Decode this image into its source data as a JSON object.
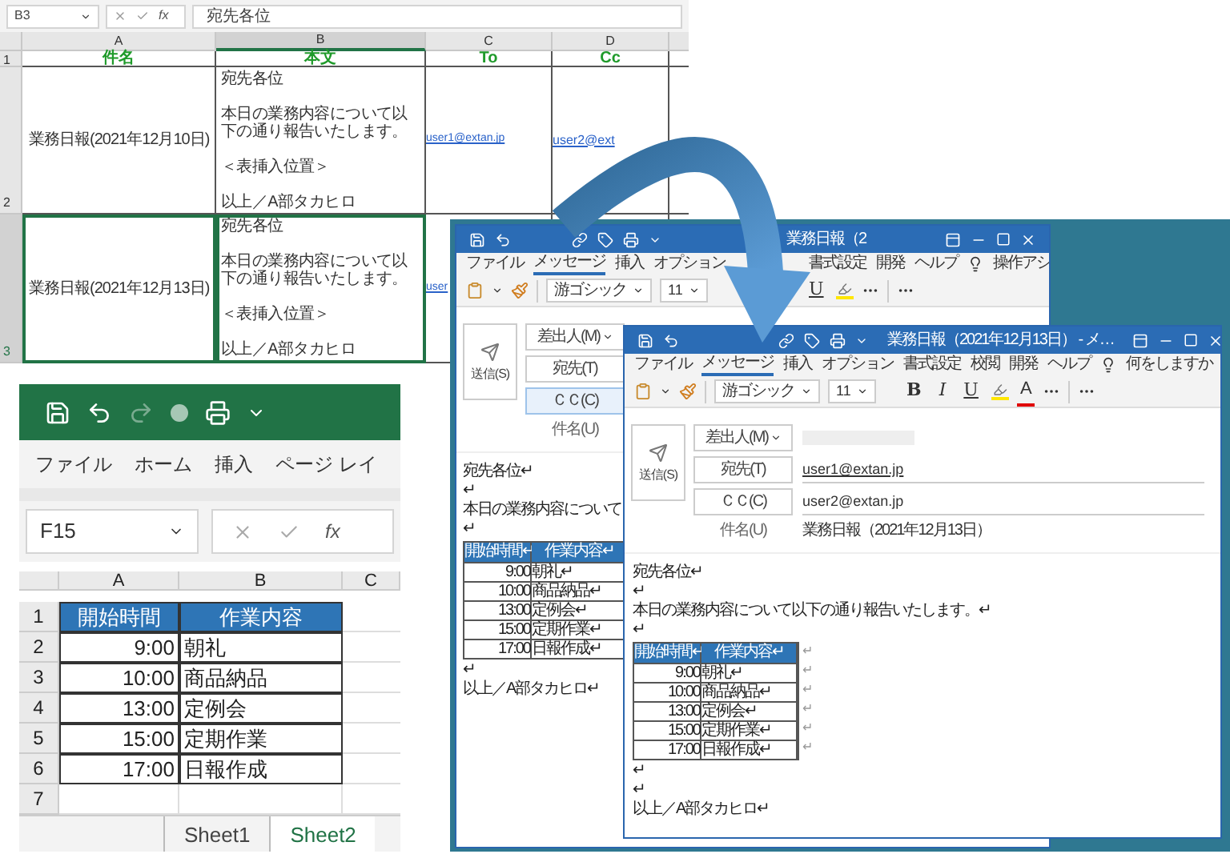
{
  "excel_top": {
    "name_box": "B3",
    "function_label": "fx",
    "formula": "宛先各位",
    "columns": [
      {
        "label": "A",
        "selected": false
      },
      {
        "label": "B",
        "selected": true
      },
      {
        "label": "C",
        "selected": false
      },
      {
        "label": "D",
        "selected": false
      }
    ],
    "header_row": {
      "number": "1",
      "cells": [
        "件名",
        "本文",
        "To",
        "Cc"
      ]
    },
    "rows": [
      {
        "number": "2",
        "selected": false,
        "subject": "業務日報(2021年12月10日)",
        "body": [
          "宛先各位",
          "本日の業務内容について以下の通り報告いたします。",
          "＜表挿入位置＞",
          "以上／A部タカヒロ"
        ],
        "to": "user1@extan.jp",
        "cc": "user2@ext"
      },
      {
        "number": "3",
        "selected": true,
        "subject": "業務日報(2021年12月13日)",
        "body": [
          "宛先各位",
          "本日の業務内容について以下の通り報告いたします。",
          "＜表挿入位置＞",
          "以上／A部タカヒロ"
        ],
        "to": "user"
      }
    ]
  },
  "excel_sheet": {
    "menu": [
      "ファイル",
      "ホーム",
      "挿入",
      "ページ レイ"
    ],
    "name_box": "F15",
    "function_label": "fx",
    "columns": [
      "A",
      "B",
      "C"
    ],
    "row_numbers": [
      "1",
      "2",
      "3",
      "4",
      "5",
      "6",
      "7"
    ],
    "table": {
      "header": [
        "開始時間",
        "作業内容"
      ],
      "rows": [
        [
          "9:00",
          "朝礼"
        ],
        [
          "10:00",
          "商品納品"
        ],
        [
          "13:00",
          "定例会"
        ],
        [
          "15:00",
          "定期作業"
        ],
        [
          "17:00",
          "日報作成"
        ]
      ]
    },
    "sheet_tabs": [
      {
        "label": "Sheet1",
        "selected": false
      },
      {
        "label": "Sheet2",
        "selected": true
      }
    ]
  },
  "back_mail": {
    "title": "業務日報（2",
    "menu": [
      {
        "label": "ファイル",
        "selected": false
      },
      {
        "label": "メッセージ",
        "selected": true
      },
      {
        "label": "挿入",
        "selected": false
      },
      {
        "label": "オプション",
        "selected": false
      },
      {
        "label": "書式設定",
        "selected": false
      },
      {
        "label": "開発",
        "selected": false
      },
      {
        "label": "ヘルプ",
        "selected": false
      }
    ],
    "tell_me": "操作アシ",
    "font": "游ゴシック",
    "size": "11",
    "format_buttons": [
      "U"
    ],
    "send": "送信(S)",
    "from_button": "差出人(M)",
    "to_button": "宛先(T)",
    "cc_button": {
      "label": "ＣＣ(C)",
      "focused": true
    },
    "subject_label": "件名(U)",
    "body": {
      "lines": [
        "宛先各位↵",
        "↵",
        "本日の業務内容について",
        "↵"
      ],
      "table": {
        "header": [
          "開始時間↵",
          "作業内容↵"
        ],
        "rows": [
          [
            "9:00",
            "朝礼↵"
          ],
          [
            "10:00",
            "商品納品↵"
          ],
          [
            "13:00",
            "定例会↵"
          ],
          [
            "15:00",
            "定期作業↵"
          ],
          [
            "17:00",
            "日報作成↵"
          ]
        ]
      },
      "after": [
        "↵",
        "以上／A部タカヒロ↵"
      ]
    }
  },
  "front_mail": {
    "title": "業務日報（2021年12月13日） - メ…",
    "menu": [
      {
        "label": "ファイル",
        "selected": false
      },
      {
        "label": "メッセージ",
        "selected": true
      },
      {
        "label": "挿入",
        "selected": false
      },
      {
        "label": "オプション",
        "selected": false
      },
      {
        "label": "書式設定",
        "selected": false
      },
      {
        "label": "校閲",
        "selected": false
      },
      {
        "label": "開発",
        "selected": false
      },
      {
        "label": "ヘルプ",
        "selected": false
      }
    ],
    "tell_me": "何をしますか",
    "font": "游ゴシック",
    "size": "11",
    "format_buttons": [
      "B",
      "I",
      "U"
    ],
    "font_color": "A",
    "send": "送信(S)",
    "from_button": "差出人(M)",
    "to_button": "宛先(T)",
    "to_value": "user1@extan.jp",
    "cc_button": {
      "label": "ＣＣ(C)",
      "focused": false
    },
    "cc_value": "user2@extan.jp",
    "subject_label": "件名(U)",
    "subject": "業務日報（2021年12月13日）",
    "body": {
      "lines": [
        "宛先各位↵",
        "↵",
        "本日の業務内容について以下の通り報告いたします。↵",
        "↵"
      ],
      "table": {
        "header": [
          "開始時間↵",
          "作業内容↵"
        ],
        "end_mark": "↵",
        "rows": [
          [
            "9:00",
            "朝礼↵"
          ],
          [
            "10:00",
            "商品納品↵"
          ],
          [
            "13:00",
            "定例会↵"
          ],
          [
            "15:00",
            "定期作業↵"
          ],
          [
            "17:00",
            "日報作成↵"
          ]
        ]
      },
      "after": [
        "↵",
        "↵",
        "以上／A部タカヒロ↵"
      ]
    }
  }
}
